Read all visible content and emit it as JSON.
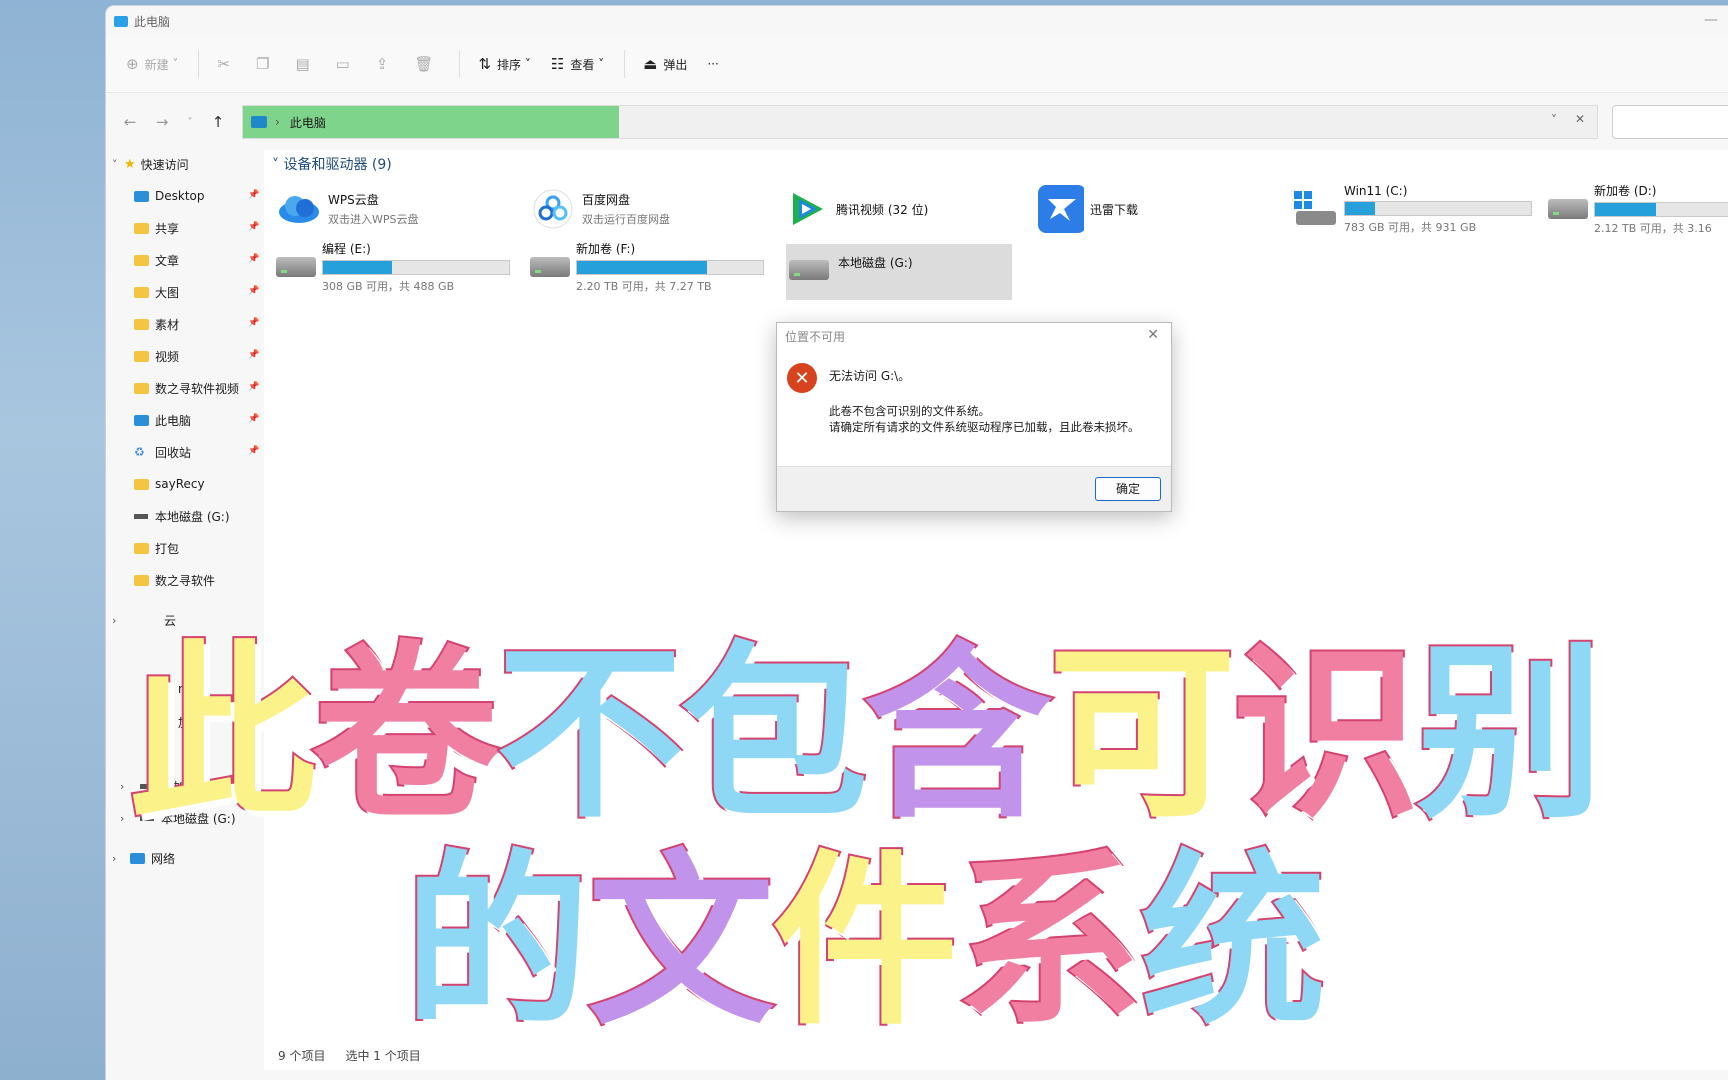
{
  "window": {
    "title": "此电脑"
  },
  "toolbar": {
    "new_label": "新建",
    "sort_label": "排序",
    "view_label": "查看",
    "eject_label": "弹出",
    "more_label": "···"
  },
  "address": {
    "path_label": "此电脑"
  },
  "sidebar": {
    "quick_access": "快速访问",
    "items": [
      {
        "label": "Desktop",
        "icon": "desktop-icon"
      },
      {
        "label": "共享",
        "icon": "folder-icon"
      },
      {
        "label": "文章",
        "icon": "folder-icon"
      },
      {
        "label": "大图",
        "icon": "folder-icon"
      },
      {
        "label": "素材",
        "icon": "folder-icon"
      },
      {
        "label": "视频",
        "icon": "folder-icon"
      },
      {
        "label": "数之寻软件视频",
        "icon": "folder-icon"
      },
      {
        "label": "此电脑",
        "icon": "pc-icon"
      },
      {
        "label": "回收站",
        "icon": "recycle-bin-icon"
      },
      {
        "label": "sayRecy",
        "icon": "folder-icon"
      },
      {
        "label": "本地磁盘 (G:)",
        "icon": "drive-icon"
      },
      {
        "label": "打包",
        "icon": "folder-icon"
      },
      {
        "label": "数之寻软件",
        "icon": "folder-icon"
      }
    ],
    "partial_cloud": "云",
    "partial_n1": "n1",
    "partial_add": "加",
    "drive_f": "新加卷 (F:)",
    "drive_g": "本地磁盘 (G:)",
    "network": "网络"
  },
  "content": {
    "section_header": "设备和驱动器 (9)",
    "tiles": [
      {
        "name": "WPS云盘",
        "sub": "双击进入WPS云盘"
      },
      {
        "name": "百度网盘",
        "sub": "双击运行百度网盘"
      },
      {
        "name": "腾讯视频 (32 位)"
      },
      {
        "name": "迅雷下载"
      },
      {
        "name": "Win11 (C:)",
        "usage": "783 GB 可用，共 931 GB",
        "used_fraction": 0.16
      },
      {
        "name": "新加卷 (D:)",
        "usage": "2.12 TB 可用，共 3.16",
        "used_fraction": 0.33
      },
      {
        "name": "编程 (E:)",
        "usage": "308 GB 可用，共 488 GB",
        "used_fraction": 0.37
      },
      {
        "name": "新加卷 (F:)",
        "usage": "2.20 TB 可用，共 7.27 TB",
        "used_fraction": 0.7
      },
      {
        "name": "本地磁盘 (G:)"
      }
    ]
  },
  "status": {
    "count": "9 个项目",
    "selected": "选中 1 个项目"
  },
  "dialog": {
    "title": "位置不可用",
    "main": "无法访问 G:\\。",
    "line1": "此卷不包含可识别的文件系统。",
    "line2": "请确定所有请求的文件系统驱动程序已加载，且此卷未损坏。",
    "ok_label": "确定"
  },
  "overlay": {
    "line1": [
      "此",
      "卷",
      "不",
      "包",
      "含",
      "可",
      "识",
      "别"
    ],
    "line2": [
      "的",
      "文",
      "件",
      "系",
      "统"
    ]
  },
  "colors": {
    "accent": "#26a0da",
    "address_highlight": "#7fd48c",
    "error": "#d8431f",
    "overlay_stroke": "#d4426f",
    "overlay_yellow": "#fbf38a",
    "overlay_pink": "#f07fa2",
    "overlay_blue": "#8fd8f5",
    "overlay_violet": "#c293ea"
  }
}
